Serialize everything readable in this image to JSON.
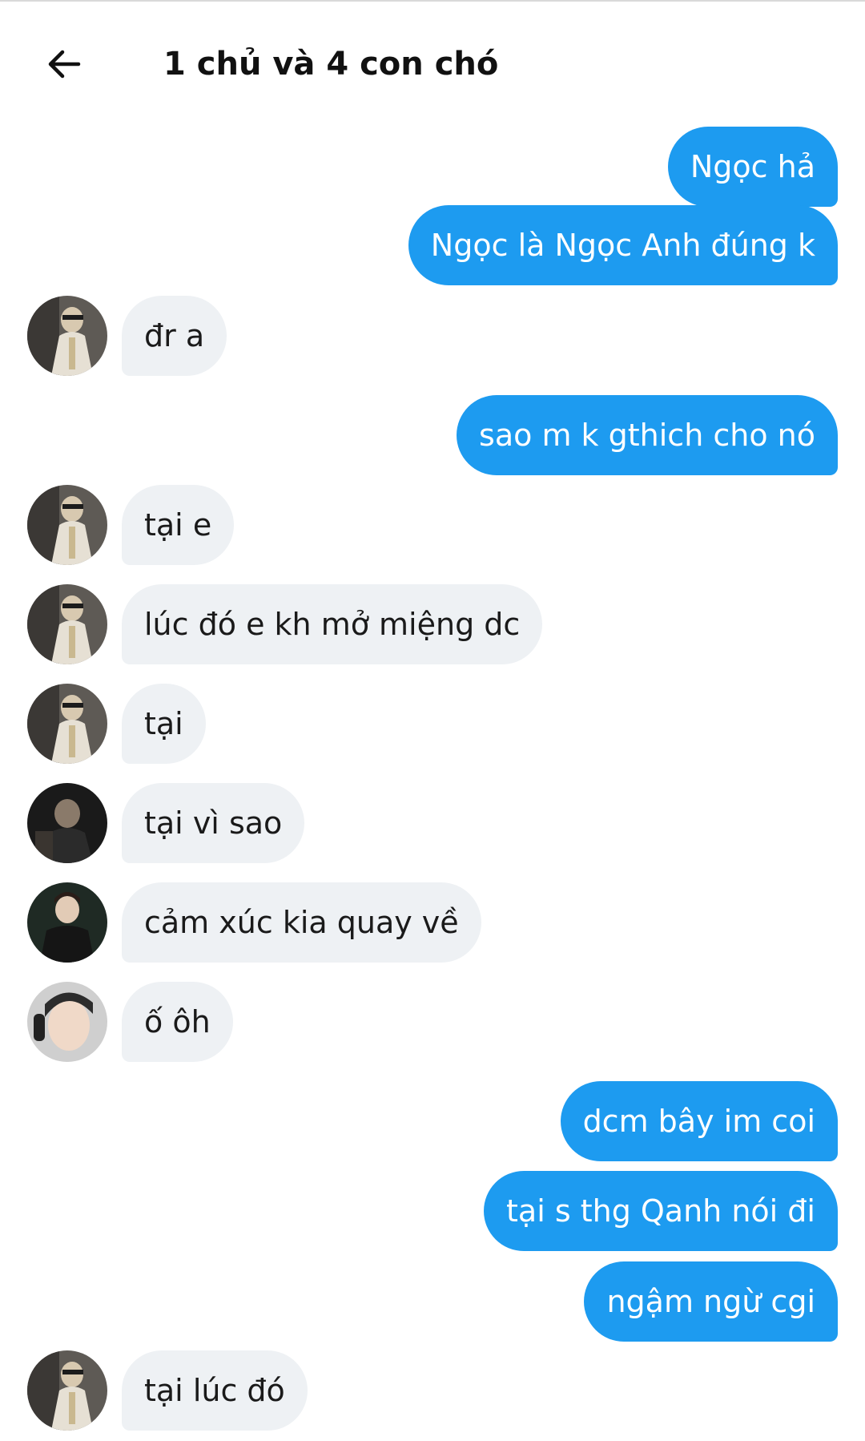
{
  "header": {
    "title": "1 chủ và 4 con chó",
    "back_icon": "arrow-left-icon"
  },
  "colors": {
    "outgoing_bubble": "#1d9bf0",
    "incoming_bubble": "#eef1f4",
    "outgoing_text": "#ffffff",
    "incoming_text": "#1a1a1a"
  },
  "messages": [
    {
      "direction": "out",
      "text": "Ngọc hả"
    },
    {
      "direction": "out",
      "text": "Ngọc là Ngọc Anh đúng k"
    },
    {
      "direction": "in",
      "avatar": "avatar-a",
      "text": "đr a"
    },
    {
      "direction": "out",
      "text": "sao m k gthich cho nó"
    },
    {
      "direction": "in",
      "avatar": "avatar-a",
      "text": "tại e"
    },
    {
      "direction": "in",
      "avatar": "avatar-a",
      "text": "lúc đó e kh mở miệng dc"
    },
    {
      "direction": "in",
      "avatar": "avatar-a",
      "text": "tại"
    },
    {
      "direction": "in",
      "avatar": "avatar-b",
      "text": "tại vì sao"
    },
    {
      "direction": "in",
      "avatar": "avatar-c",
      "text": "cảm xúc kia quay về"
    },
    {
      "direction": "in",
      "avatar": "avatar-d",
      "text": "ố ôh"
    },
    {
      "direction": "out",
      "text": "dcm bây im coi"
    },
    {
      "direction": "out",
      "text": "tại s thg Qanh nói đi"
    },
    {
      "direction": "out",
      "text": "ngậm ngừ cgi"
    },
    {
      "direction": "in",
      "avatar": "avatar-a",
      "text": "tại lúc đó"
    }
  ]
}
